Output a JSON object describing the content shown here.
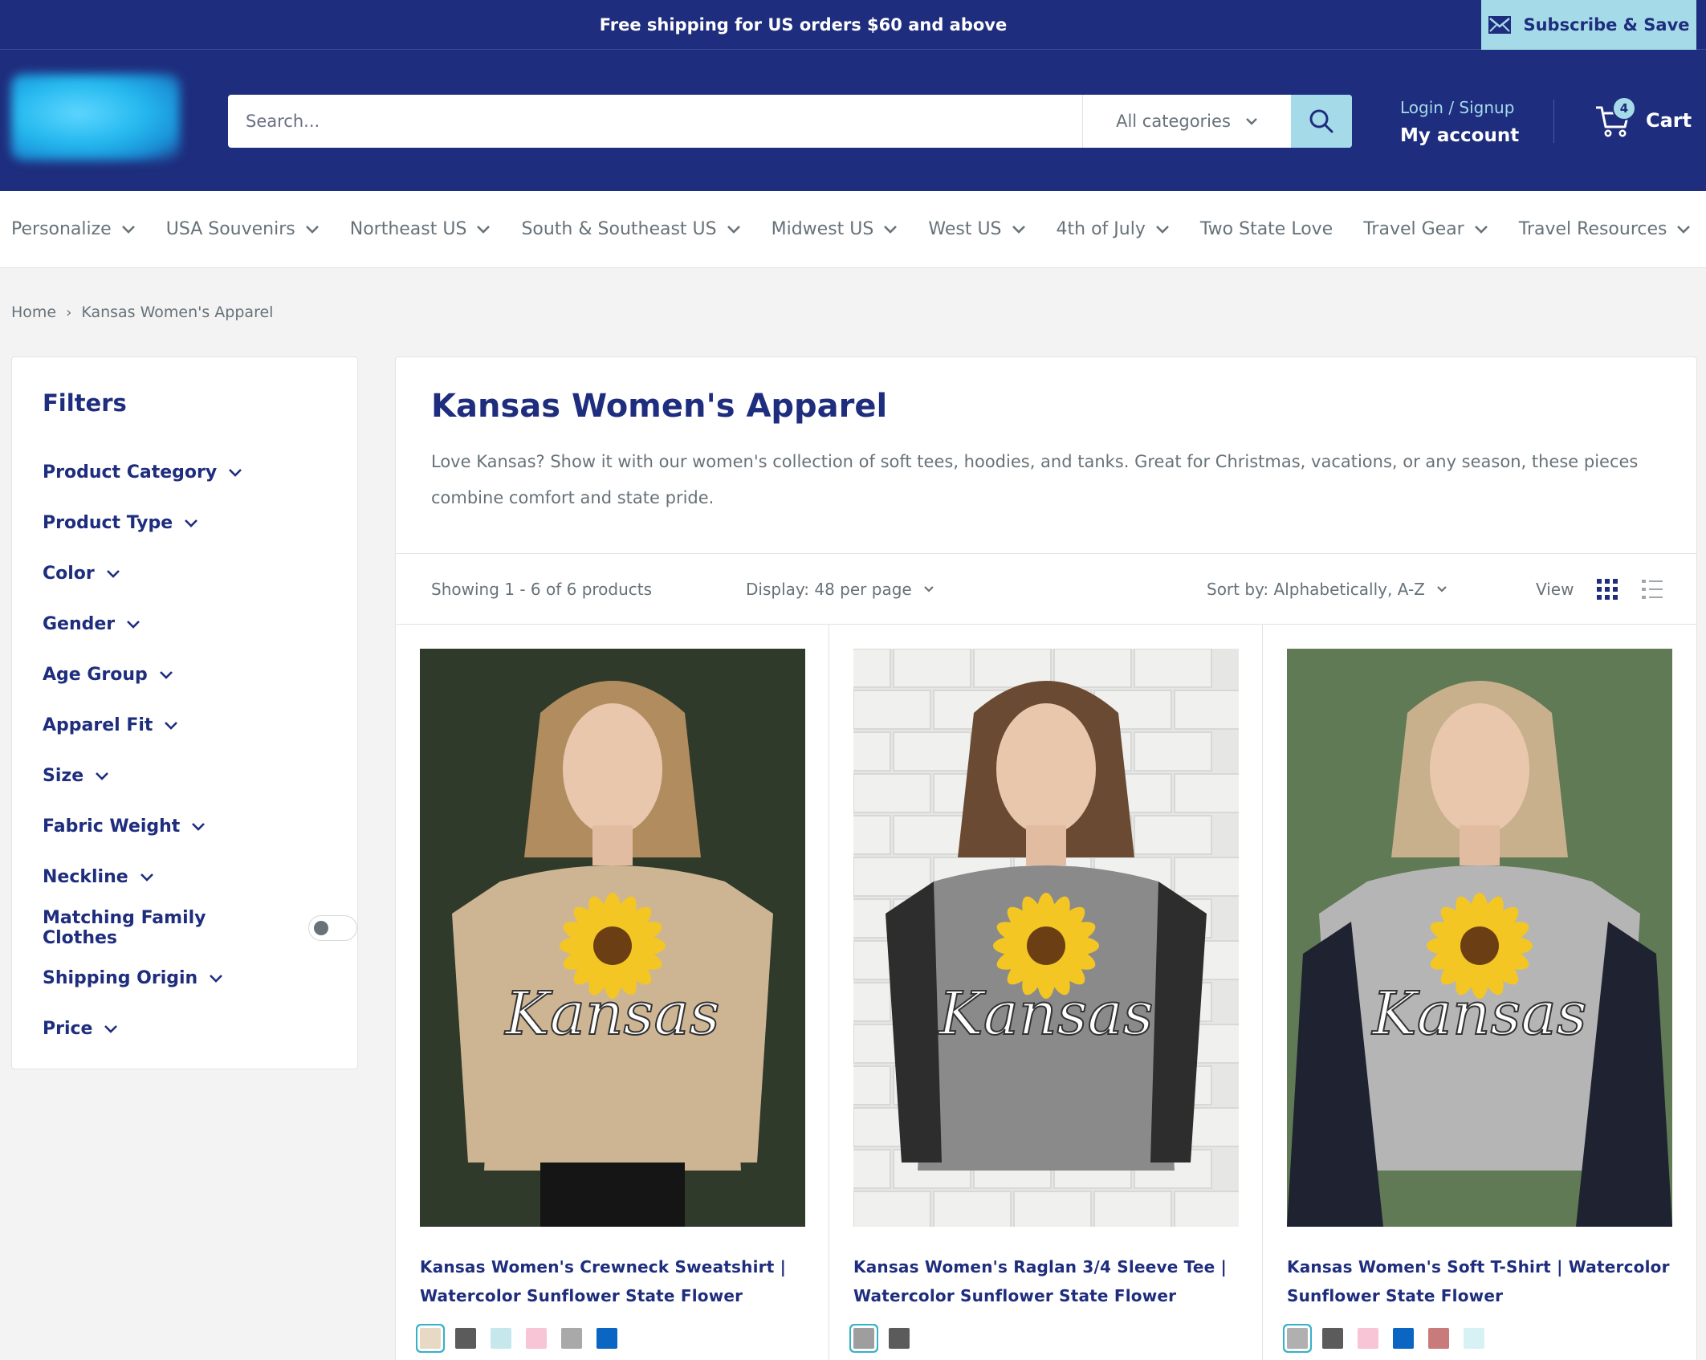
{
  "announcement": {
    "text": "Free shipping for US orders $60 and above"
  },
  "subscribe": {
    "label": "Subscribe & Save",
    "icon": "mail-icon"
  },
  "header": {
    "search_placeholder": "Search...",
    "category_label": "All categories",
    "login_label": "Login / Signup",
    "account_label": "My account",
    "cart_label": "Cart",
    "cart_count": "4"
  },
  "nav": {
    "items": [
      {
        "label": "Personalize",
        "dropdown": true
      },
      {
        "label": "USA Souvenirs",
        "dropdown": true
      },
      {
        "label": "Northeast US",
        "dropdown": true
      },
      {
        "label": "South & Southeast US",
        "dropdown": true
      },
      {
        "label": "Midwest US",
        "dropdown": true
      },
      {
        "label": "West US",
        "dropdown": true
      },
      {
        "label": "4th of July",
        "dropdown": true
      },
      {
        "label": "Two State Love",
        "dropdown": false
      },
      {
        "label": "Travel Gear",
        "dropdown": true
      },
      {
        "label": "Travel Resources",
        "dropdown": true
      }
    ]
  },
  "breadcrumb": {
    "home": "Home",
    "separator": "›",
    "current": "Kansas Women's Apparel"
  },
  "filters": {
    "title": "Filters",
    "items": [
      {
        "label": "Product Category",
        "type": "dropdown"
      },
      {
        "label": "Product Type",
        "type": "dropdown"
      },
      {
        "label": "Color",
        "type": "dropdown"
      },
      {
        "label": "Gender",
        "type": "dropdown"
      },
      {
        "label": "Age Group",
        "type": "dropdown"
      },
      {
        "label": "Apparel Fit",
        "type": "dropdown"
      },
      {
        "label": "Size",
        "type": "dropdown"
      },
      {
        "label": "Fabric Weight",
        "type": "dropdown"
      },
      {
        "label": "Neckline",
        "type": "dropdown"
      },
      {
        "label": "Matching Family Clothes",
        "type": "toggle"
      },
      {
        "label": "Shipping Origin",
        "type": "dropdown"
      },
      {
        "label": "Price",
        "type": "dropdown"
      }
    ]
  },
  "collection": {
    "title": "Kansas Women's Apparel",
    "description": "Love Kansas? Show it with our women's collection of soft tees, hoodies, and tanks. Great for Christmas, vacations, or any season, these pieces combine comfort and state pride."
  },
  "toolbar": {
    "showing": "Showing 1 - 6 of 6 products",
    "display": "Display: 48 per page",
    "sort": "Sort by: Alphabetically, A-Z",
    "view_label": "View"
  },
  "products": [
    {
      "title": "Kansas Women's Crewneck Sweatshirt | Watercolor Sunflower State Flower",
      "swatches": [
        "#e8d9c4",
        "#5b5b5b",
        "#c6e8ec",
        "#f7c5d5",
        "#a9a9a9",
        "#0a66c2"
      ],
      "selected": 0
    },
    {
      "title": "Kansas Women's Raglan 3/4 Sleeve Tee | Watercolor Sunflower State Flower",
      "swatches": [
        "#9e9e9e",
        "#5b5b5b"
      ],
      "selected": 0
    },
    {
      "title": "Kansas Women's Soft T-Shirt | Watercolor Sunflower State Flower",
      "swatches": [
        "#b0b0b0",
        "#5b5b5b",
        "#f7c5d5",
        "#0a66c2",
        "#c97a7a",
        "#d6f2f4"
      ],
      "selected": 0
    }
  ],
  "product_print_text": "Kansas",
  "colors": {
    "brand": "#1e2d7d",
    "accent": "#a5dbe8",
    "muted": "#677279"
  }
}
